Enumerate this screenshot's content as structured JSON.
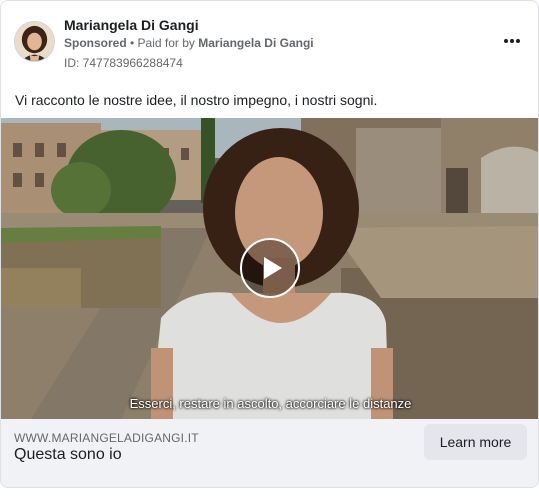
{
  "post": {
    "advertiser_name": "Mariangela Di Gangi",
    "sponsored_label": "Sponsored",
    "separator": " • ",
    "paid_for_prefix": "Paid for by ",
    "paid_for_name": "Mariangela Di Gangi",
    "ad_id": "ID: 747783966288474",
    "body": "Vi racconto le nostre idee, il nostro impegno, i nostri sogni.",
    "more_icon": "more-horizontal-icon"
  },
  "video": {
    "subtitle": "Esserci, restare in ascolto, accorciare le distanze",
    "play_icon": "play-icon"
  },
  "link_card": {
    "domain": "WWW.MARIANGELADIGANGI.IT",
    "headline": "Questa sono io",
    "cta_label": "Learn more"
  },
  "colors": {
    "card_border": "#dddfe2",
    "footer_bg": "#f0f2f5",
    "cta_bg": "#e4e6eb",
    "secondary_text": "#65676b",
    "primary_text": "#1c1e21"
  }
}
